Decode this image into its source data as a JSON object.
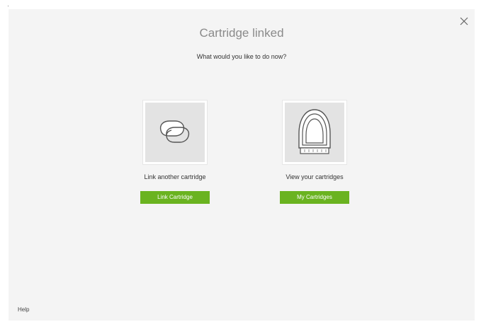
{
  "dialog": {
    "title": "Cartridge linked",
    "subtitle": "What would you like to do now?",
    "close_icon": "close-icon"
  },
  "options": {
    "link": {
      "icon": "link-chain-icon",
      "label": "Link another cartridge",
      "button": "Link Cartridge"
    },
    "view": {
      "icon": "cartridge-icon",
      "label": "View your cartridges",
      "button": "My Cartridges"
    }
  },
  "footer": {
    "help": "Help"
  },
  "colors": {
    "accent": "#6ab320",
    "dialog_bg": "#f4f4f4",
    "tile_bg": "#e3e3e3",
    "title": "#8a8a8a"
  }
}
